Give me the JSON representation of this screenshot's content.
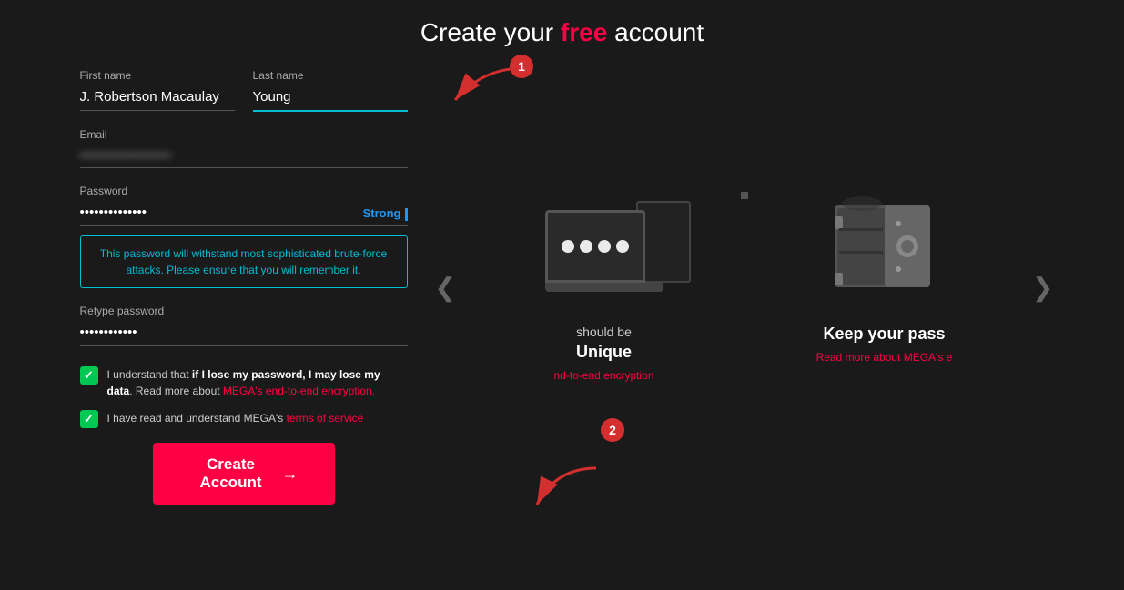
{
  "page": {
    "title_prefix": "Create your ",
    "title_highlight": "free",
    "title_suffix": " account"
  },
  "form": {
    "first_name_label": "First name",
    "first_name_value": "J. Robertson Macaulay",
    "last_name_label": "Last name",
    "last_name_value": "Young",
    "email_label": "Email",
    "email_value": "••••••••••••••••••",
    "password_label": "Password",
    "password_value": "••••••••••••••",
    "password_strength": "Strong",
    "password_hint": "This password will withstand most sophisticated brute-force attacks. Please ensure that you will remember it.",
    "retype_label": "Retype password",
    "retype_value": "••••••••••••",
    "checkbox1_text_normal_1": "I understand that ",
    "checkbox1_text_bold": "if I lose my password, I may lose my data",
    "checkbox1_text_normal_2": ". Read more about ",
    "checkbox1_link_text": "MEGA's end-to-end encryption.",
    "checkbox2_text_normal": "I have read and understand MEGA's ",
    "checkbox2_link_text": "terms of service",
    "create_btn_label": "Create Account",
    "create_btn_arrow": "→"
  },
  "carousel": {
    "left_nav": "❮",
    "right_nav": "❯",
    "card1": {
      "subtitle": "should be",
      "title": "Unique",
      "link_text": "nd-to-end encryption"
    },
    "card2": {
      "title_partial": "Keep your pass",
      "link_text": "Read more about MEGA's e"
    }
  },
  "annotations": {
    "bubble1": "1",
    "bubble2": "2"
  }
}
